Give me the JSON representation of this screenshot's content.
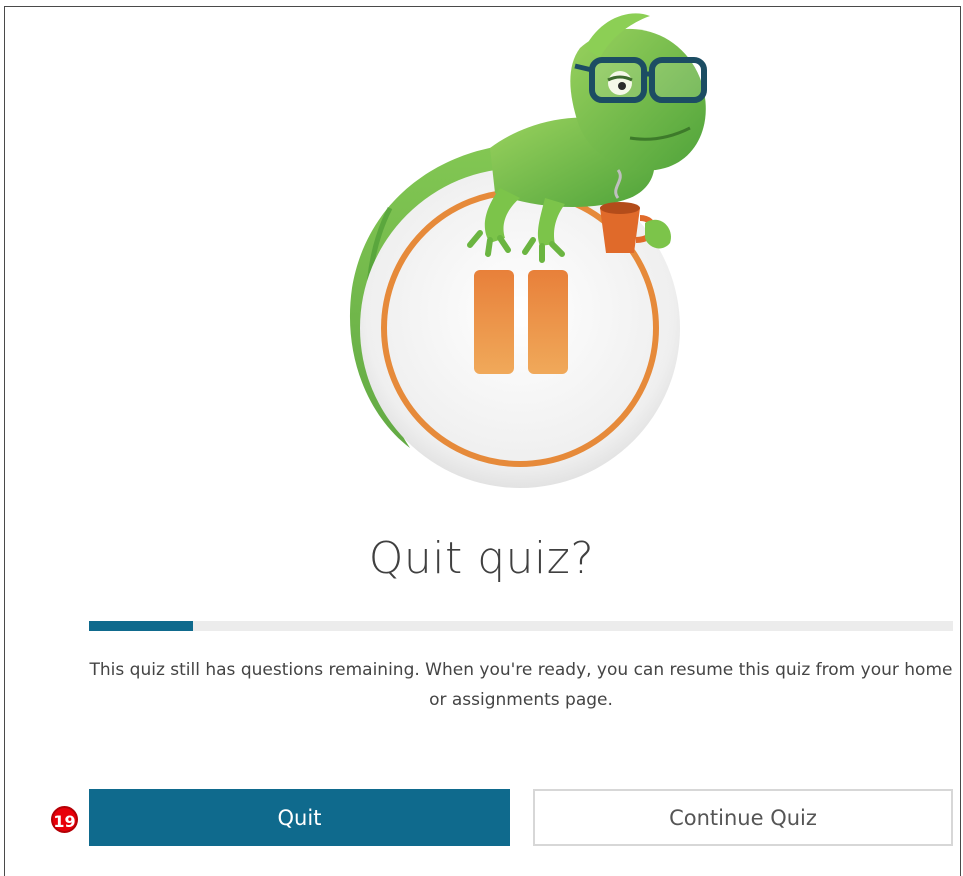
{
  "dialog": {
    "title": "Quit quiz?",
    "message": "This quiz still has questions remaining. When you're ready, you can resume this quiz from your home or assignments page.",
    "progress_fraction": 0.12,
    "step_badge": "19"
  },
  "buttons": {
    "quit_label": "Quit",
    "continue_label": "Continue Quiz"
  },
  "illustration": {
    "icon": "chameleon-pause-icon",
    "colors": {
      "accent": "#0f6a8d",
      "orange": "#e8893d",
      "green": "#7cc44a"
    }
  }
}
